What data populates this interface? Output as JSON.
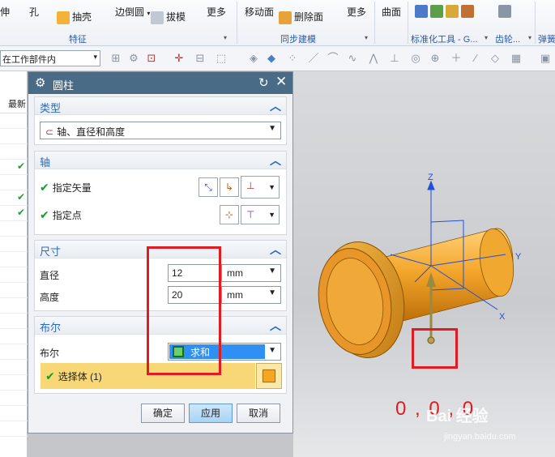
{
  "ribbon": {
    "items": {
      "extrude_partial": "伸",
      "hole": "孔",
      "shell": "抽壳",
      "edge_blend": "边倒圆",
      "draft": "拔模",
      "more1": "更多",
      "move_face": "移动面",
      "delete_face": "删除面",
      "more2": "更多",
      "curve": "曲面"
    },
    "groups": {
      "feature": "特征",
      "sync_modeling": "同步建模",
      "std_parts": "标准化工具 - G...",
      "gear": "齿轮...",
      "spring": "弹簧"
    }
  },
  "toolbar2": {
    "selection_scope": "在工作部件内"
  },
  "leftlist": {
    "header": "最新"
  },
  "dialog": {
    "title": "圆柱",
    "type_section": {
      "title": "类型",
      "value": "轴、直径和高度"
    },
    "axis_section": {
      "title": "轴",
      "specify_vector": "指定矢量",
      "specify_point": "指定点"
    },
    "dimensions_section": {
      "title": "尺寸",
      "diameter_label": "直径",
      "diameter_value": "12",
      "diameter_unit": "mm",
      "height_label": "高度",
      "height_value": "20",
      "height_unit": "mm"
    },
    "boolean_section": {
      "title": "布尔",
      "label": "布尔",
      "value": "求和",
      "select_body": "选择体 (1)"
    },
    "buttons": {
      "ok": "确定",
      "apply": "应用",
      "cancel": "取消"
    }
  },
  "viewport": {
    "axis_z": "Z",
    "axis_y": "Y",
    "axis_x": "X",
    "coords": "0 , 0 , 0"
  },
  "watermark": {
    "brand": "Bai 经验",
    "url": "jingyan.baidu.com"
  },
  "colors": {
    "accent": "#2a6ab8",
    "title_bar": "#4a6b85",
    "highlight": "#e01b22",
    "part": "#f0a020"
  }
}
